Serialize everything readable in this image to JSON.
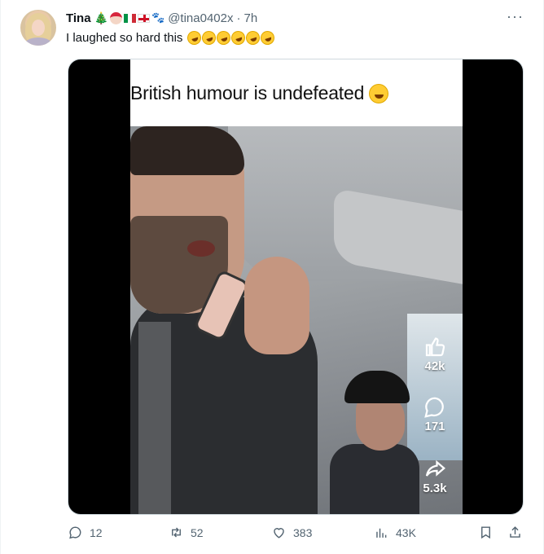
{
  "tweet": {
    "author_name": "Tina",
    "author_badges": [
      "christmas-tree-emoji",
      "santa-emoji",
      "italy-flag-emoji",
      "england-flag-emoji",
      "paw-prints-emoji"
    ],
    "handle": "@tina0402x",
    "separator": "·",
    "time": "7h",
    "text": "I laughed so hard this",
    "text_emoji": "rolling-on-floor-laughing-emoji",
    "text_emoji_count": 6,
    "more_label": "···"
  },
  "media": {
    "caption": "British humour is undefeated",
    "caption_emoji": "grinning-sweat-emoji",
    "overlay": {
      "likes": "42k",
      "comments": "171",
      "shares": "5.3k"
    }
  },
  "actions": {
    "replies": "12",
    "reposts": "52",
    "likes": "383",
    "views": "43K"
  },
  "colors": {
    "text_primary": "#0f1419",
    "text_secondary": "#536471",
    "border": "#eff3f4"
  }
}
